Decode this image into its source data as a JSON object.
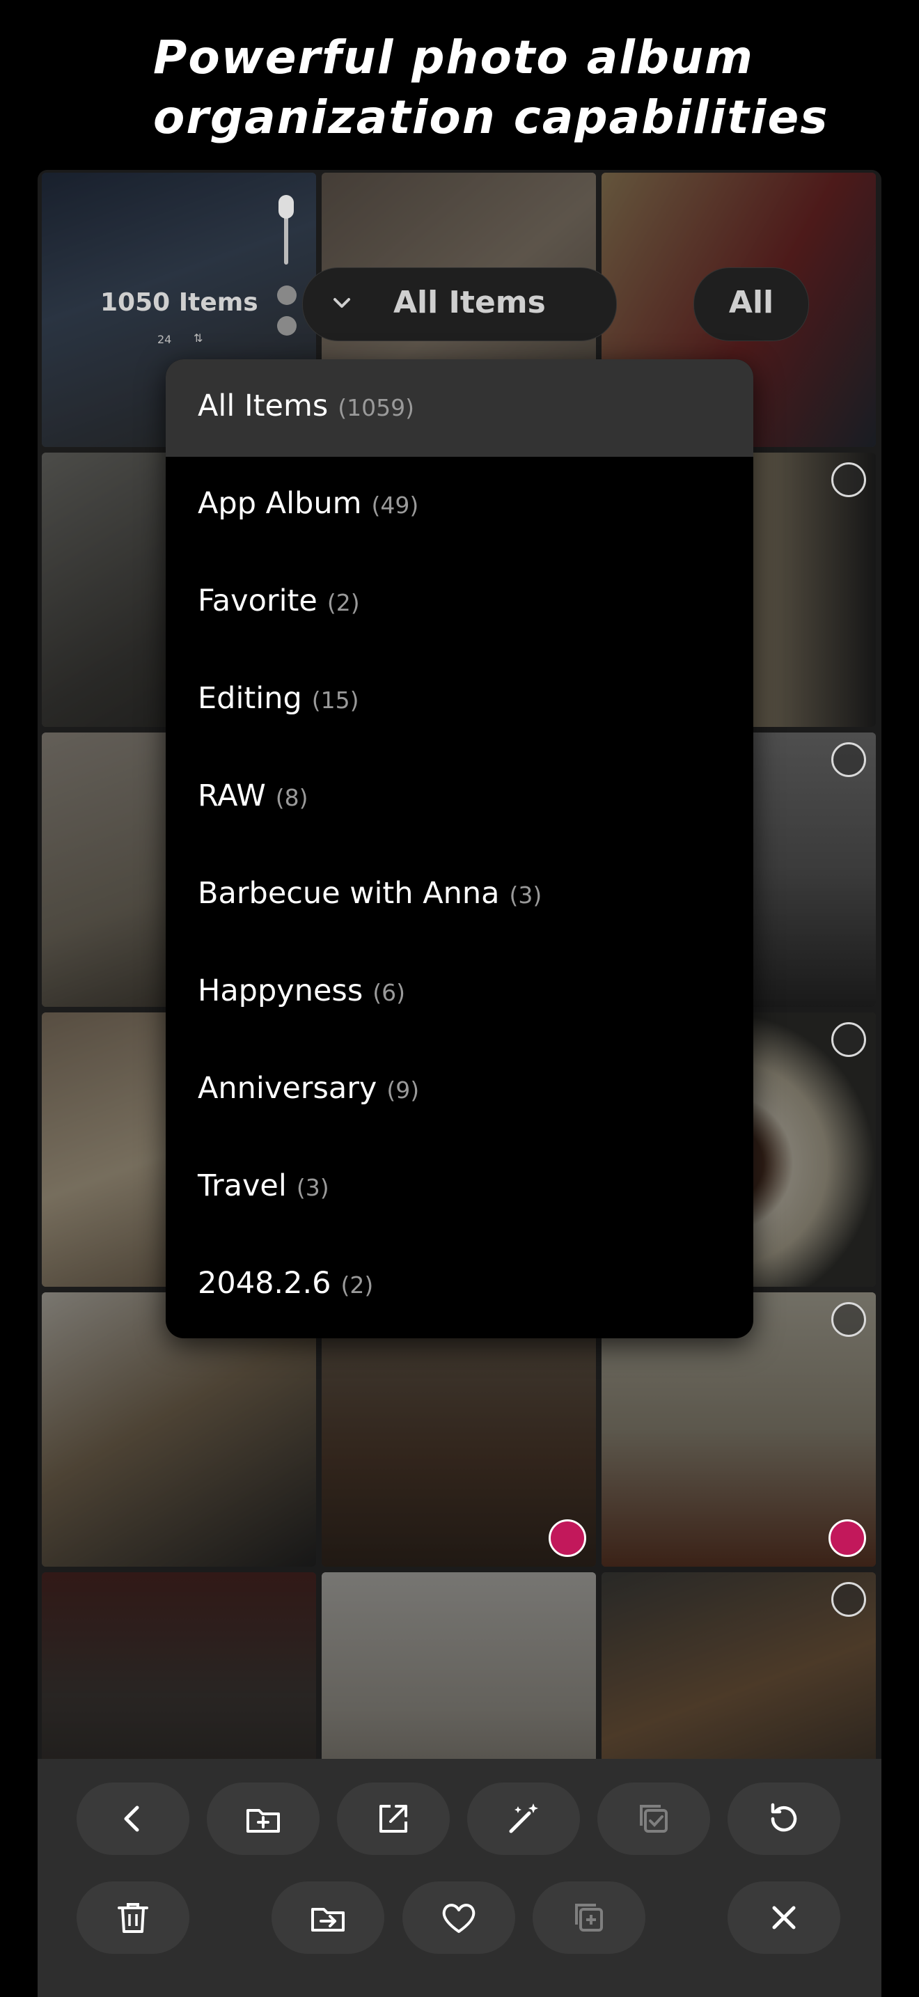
{
  "headline": "Powerful photo album organization capabilities",
  "headline_lines": [
    "Powerful photo album",
    "organization capabilities"
  ],
  "top_bar": {
    "count_label": "1050 Items",
    "mini_text_a": "24",
    "album_selector_label": "All Items",
    "filter_label": "All"
  },
  "dropdown": {
    "items": [
      {
        "label": "All Items",
        "count": "(1059)",
        "selected": true
      },
      {
        "label": "App Album",
        "count": "(49)"
      },
      {
        "label": "Favorite",
        "count": "(2)"
      },
      {
        "label": "Editing",
        "count": "(15)"
      },
      {
        "label": "RAW",
        "count": "(8)"
      },
      {
        "label": "Barbecue with Anna",
        "count": "(3)"
      },
      {
        "label": "Happyness",
        "count": "(6)"
      },
      {
        "label": "Anniversary",
        "count": "(9)"
      },
      {
        "label": "Travel",
        "count": "(3)"
      },
      {
        "label": "2048.2.6",
        "count": "(2)"
      }
    ]
  },
  "toolbar": {
    "row1": [
      "back-icon",
      "add-to-album-icon",
      "share-icon",
      "magic-wand-icon",
      "select-icon",
      "rotate-icon"
    ],
    "row2": [
      "trash-icon",
      "move-icon",
      "heart-icon",
      "duplicate-icon",
      "close-icon"
    ]
  },
  "colors": {
    "background": "#000000",
    "dropdown_selected": "#333333",
    "check_badge": "#c2185b",
    "toolbar": "#2e2e2e"
  }
}
